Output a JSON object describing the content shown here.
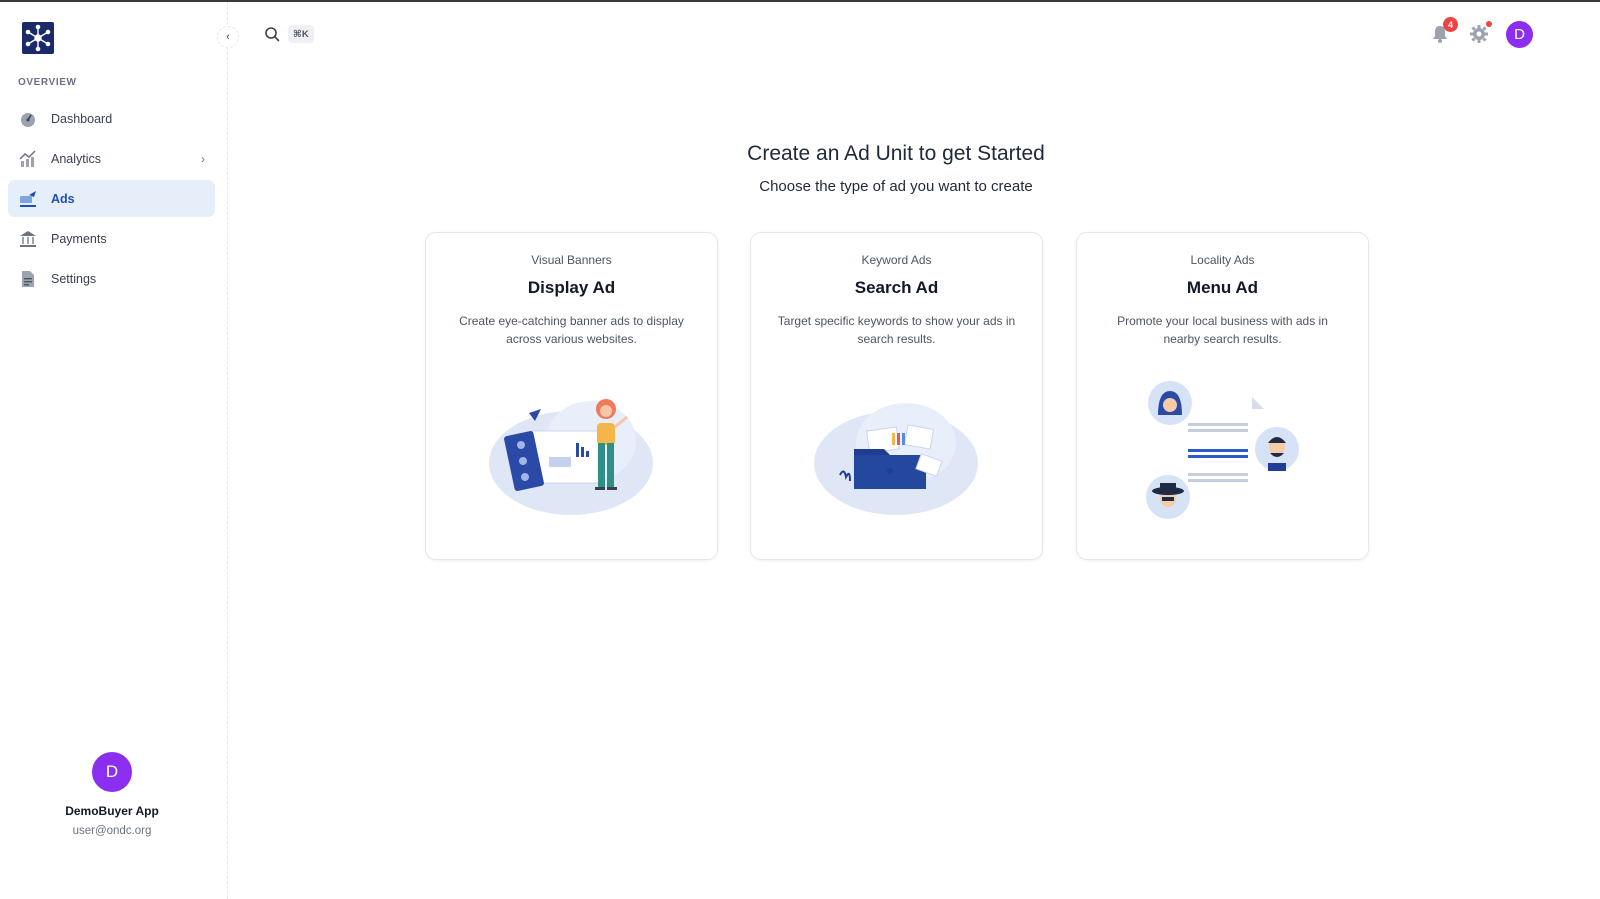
{
  "sidebar": {
    "section_label": "OVERVIEW",
    "collapse_glyph": "‹",
    "items": [
      {
        "label": "Dashboard",
        "icon": "gauge-icon",
        "active": false
      },
      {
        "label": "Analytics",
        "icon": "chart-icon",
        "active": false,
        "has_submenu": true
      },
      {
        "label": "Ads",
        "icon": "ads-icon",
        "active": true
      },
      {
        "label": "Payments",
        "icon": "bank-icon",
        "active": false
      },
      {
        "label": "Settings",
        "icon": "document-icon",
        "active": false
      }
    ],
    "chevron": "›",
    "profile": {
      "initial": "D",
      "name": "DemoBuyer App",
      "email": "user@ondc.org"
    }
  },
  "header": {
    "search_shortcut": "⌘K",
    "notification_count": "4",
    "avatar_initial": "D"
  },
  "main": {
    "title": "Create an Ad Unit to get Started",
    "subtitle": "Choose the type of ad you want to create",
    "cards": [
      {
        "eyebrow": "Visual Banners",
        "title": "Display Ad",
        "description": "Create eye-catching banner ads to display across various websites."
      },
      {
        "eyebrow": "Keyword Ads",
        "title": "Search Ad",
        "description": "Target specific keywords to show your ads in search results."
      },
      {
        "eyebrow": "Locality Ads",
        "title": "Menu Ad",
        "description": "Promote your local business with ads in nearby search results."
      }
    ]
  },
  "colors": {
    "accent": "#1e4fb4",
    "active_bg": "#e6eef9",
    "avatar": "#8b2ef0",
    "badge": "#ef4444",
    "logo_bg": "#1b2a6b"
  }
}
